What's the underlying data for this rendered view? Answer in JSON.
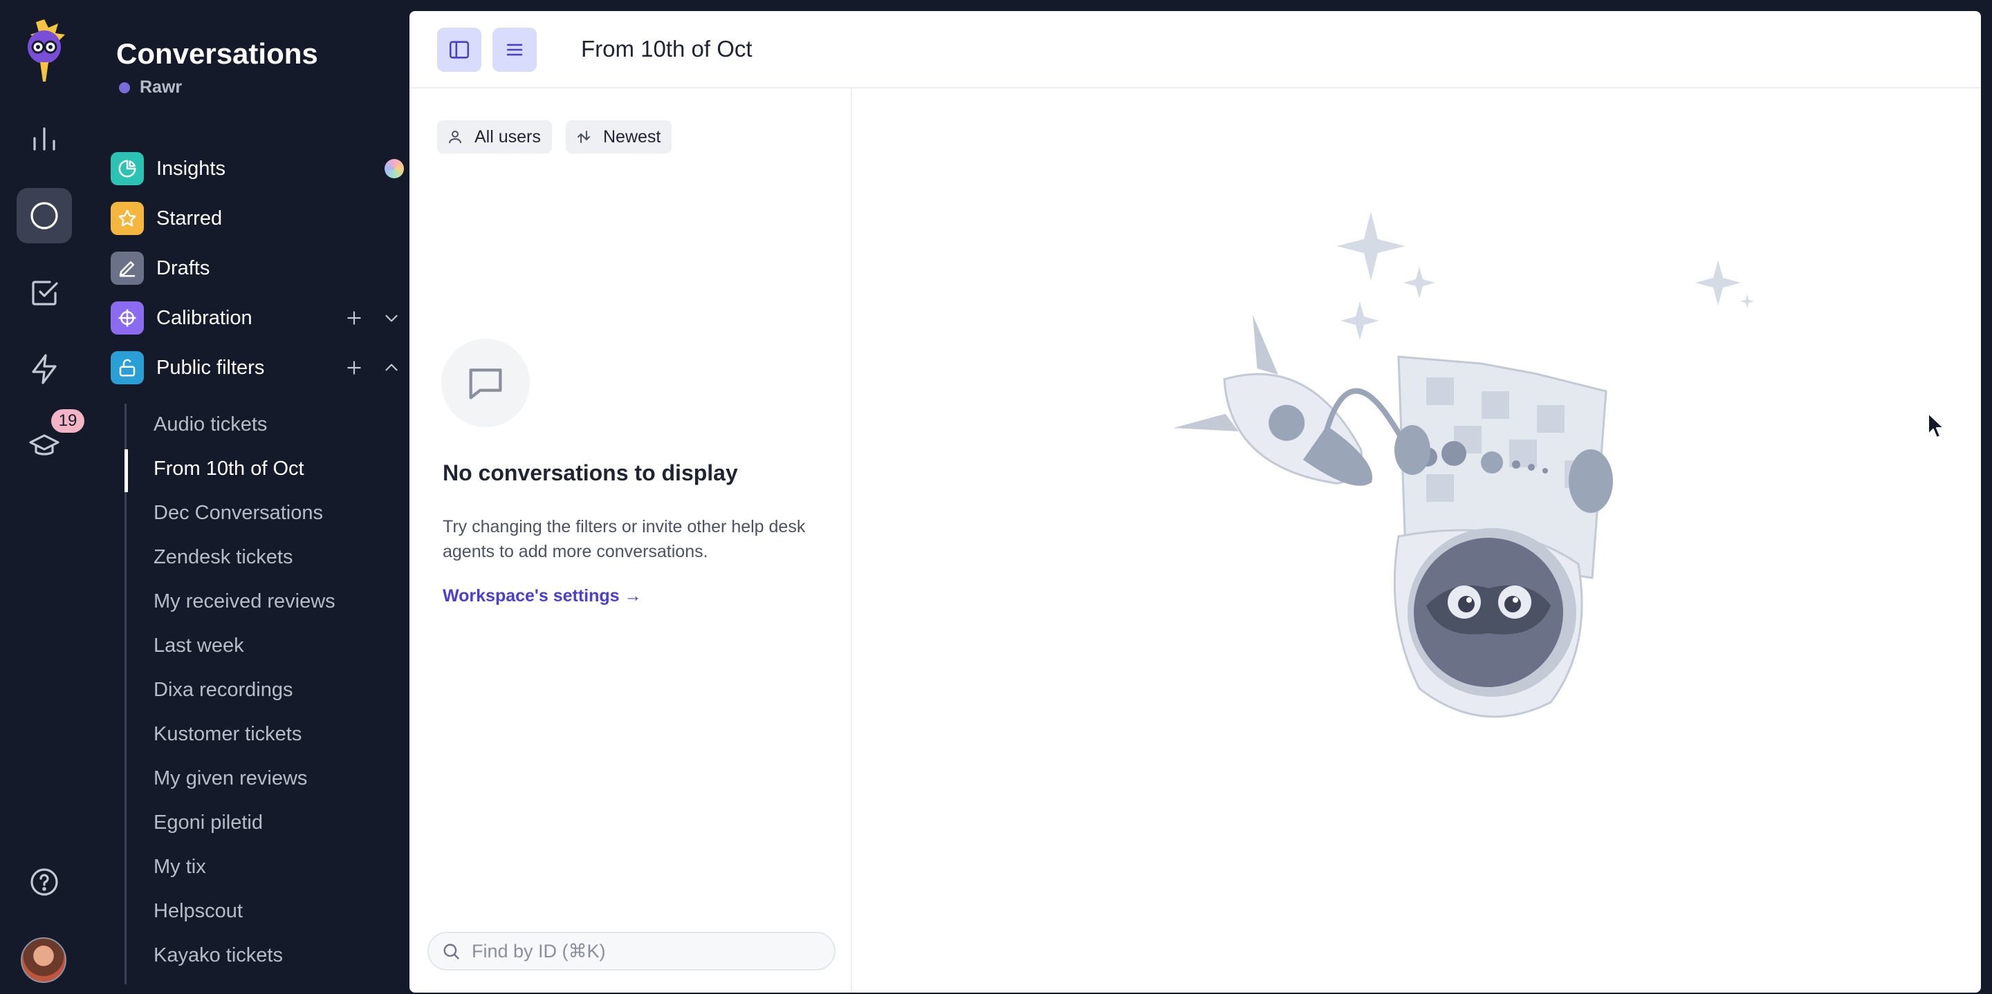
{
  "rail": {
    "badge_count": "19"
  },
  "nav": {
    "title": "Conversations",
    "workspace": "Rawr",
    "items": [
      {
        "label": "Insights",
        "icon": "pie-chart-icon",
        "color": "#2cc3b5"
      },
      {
        "label": "Starred",
        "icon": "star-icon",
        "color": "#f5b63d"
      },
      {
        "label": "Drafts",
        "icon": "pencil-icon",
        "color": "#6b7287"
      },
      {
        "label": "Calibration",
        "icon": "crosshair-icon",
        "color": "#8b6cf0"
      },
      {
        "label": "Public filters",
        "icon": "unlock-icon",
        "color": "#2a9fd6"
      }
    ],
    "filters": [
      "Audio tickets",
      "From 10th of Oct",
      "Dec Conversations",
      "Zendesk tickets",
      "My received reviews",
      "Last week",
      "Dixa recordings",
      "Kustomer tickets",
      "My given reviews",
      "Egoni piletid",
      "My tix",
      "Helpscout",
      "Kayako tickets"
    ],
    "active_filter": "From 10th of Oct"
  },
  "main": {
    "page_title": "From 10th of Oct",
    "chips": {
      "users": "All users",
      "sort": "Newest"
    },
    "empty": {
      "title": "No conversations to display",
      "text": "Try changing the filters or invite other help desk agents to add more conversations.",
      "link": "Workspace's settings →"
    },
    "search_placeholder": "Find by ID (⌘K)"
  },
  "colors": {
    "sidebar_bg": "#151a2b",
    "accent": "#4a3fcf",
    "toolbar_button": "#d9dcfb"
  }
}
